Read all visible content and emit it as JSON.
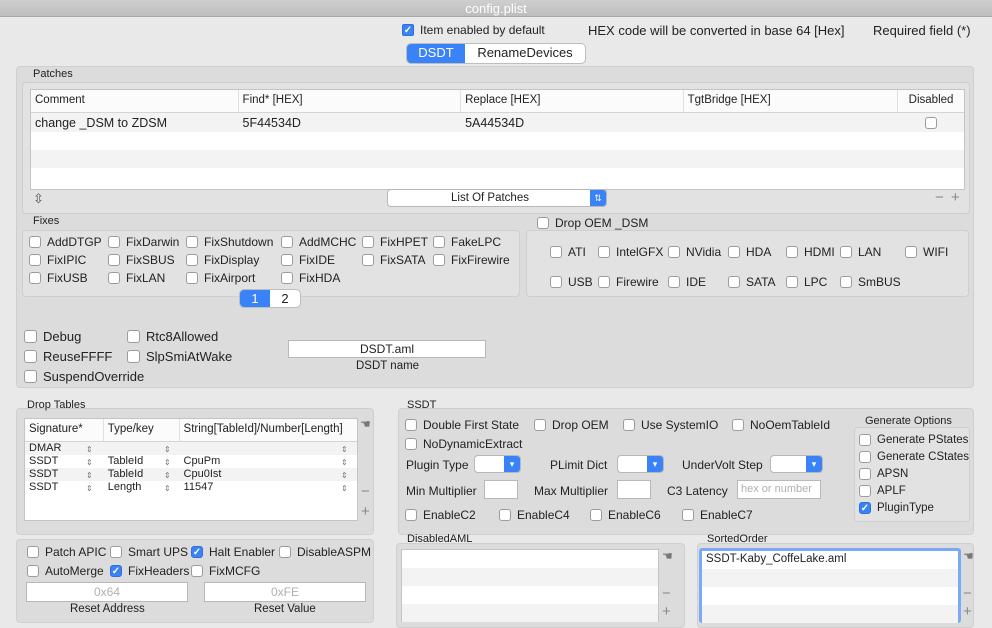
{
  "window": {
    "title": "config.plist"
  },
  "header": {
    "item_enabled_label": "Item enabled by default",
    "hex_note": "HEX code will be converted in base 64 [Hex]",
    "required_note": "Required field (*)"
  },
  "tabs": [
    "DSDT",
    "RenameDevices"
  ],
  "patches": {
    "title": "Patches",
    "columns": [
      "Comment",
      "Find* [HEX]",
      "Replace [HEX]",
      "TgtBridge [HEX]",
      "Disabled"
    ],
    "rows": [
      {
        "comment": "change _DSM to ZDSM",
        "find": "5F44534D",
        "replace": "5A44534D",
        "tgt": ""
      }
    ],
    "list_popup": "List Of Patches"
  },
  "fixes": {
    "title": "Fixes",
    "items": [
      "AddDTGP",
      "FixDarwin",
      "FixShutdown",
      "AddMCHC",
      "FixHPET",
      "FakeLPC",
      "FixIPIC",
      "FixSBUS",
      "FixDisplay",
      "FixIDE",
      "FixSATA",
      "FixFirewire",
      "FixUSB",
      "FixLAN",
      "FixAirport",
      "FixHDA"
    ],
    "pages": [
      "1",
      "2"
    ]
  },
  "drop_oem": {
    "title": "Drop OEM _DSM",
    "items": [
      "ATI",
      "IntelGFX",
      "NVidia",
      "HDA",
      "HDMI",
      "LAN",
      "WIFI",
      "USB",
      "Firewire",
      "IDE",
      "SATA",
      "LPC",
      "SmBUS"
    ]
  },
  "dsdt_options": {
    "items": [
      "Debug",
      "Rtc8Allowed",
      "ReuseFFFF",
      "SlpSmiAtWake",
      "SuspendOverride"
    ],
    "dsdt_name_value": "DSDT.aml",
    "dsdt_name_label": "DSDT name"
  },
  "drop_tables": {
    "title": "Drop Tables",
    "columns": [
      "Signature*",
      "Type/key",
      "String[TableId]/Number[Length]"
    ],
    "rows": [
      {
        "sig": "DMAR",
        "type": "",
        "value": ""
      },
      {
        "sig": "SSDT",
        "type": "TableId",
        "value": "CpuPm"
      },
      {
        "sig": "SSDT",
        "type": "TableId",
        "value": "Cpu0Ist"
      },
      {
        "sig": "SSDT",
        "type": "Length",
        "value": "11547"
      }
    ]
  },
  "ssdt": {
    "title": "SSDT",
    "checks": [
      "Double First State",
      "Drop OEM",
      "Use SystemIO",
      "NoOemTableId",
      "NoDynamicExtract"
    ],
    "plugin_type_label": "Plugin Type",
    "plimit_label": "PLimit Dict",
    "undervolt_label": "UnderVolt Step",
    "min_mult_label": "Min Multiplier",
    "max_mult_label": "Max Multiplier",
    "c3_label": "C3 Latency",
    "c3_placeholder": "hex or number",
    "enable_checks": [
      "EnableC2",
      "EnableC4",
      "EnableC6",
      "EnableC7"
    ],
    "generate_title": "Generate Options",
    "generate": [
      {
        "label": "Generate PStates",
        "checked": false
      },
      {
        "label": "Generate CStates",
        "checked": false
      },
      {
        "label": "APSN",
        "checked": false
      },
      {
        "label": "APLF",
        "checked": false
      },
      {
        "label": "PluginType",
        "checked": true
      }
    ]
  },
  "misc": {
    "items": [
      {
        "label": "Patch APIC",
        "checked": false
      },
      {
        "label": "Smart UPS",
        "checked": false
      },
      {
        "label": "Halt Enabler",
        "checked": true
      },
      {
        "label": "DisableASPM",
        "checked": false
      },
      {
        "label": "AutoMerge",
        "checked": false
      },
      {
        "label": "FixHeaders",
        "checked": true
      },
      {
        "label": "FixMCFG",
        "checked": false
      }
    ],
    "reset_address_placeholder": "0x64",
    "reset_address_label": "Reset Address",
    "reset_value_placeholder": "0xFE",
    "reset_value_label": "Reset Value"
  },
  "disabled_aml": {
    "title": "DisabledAML"
  },
  "sorted_order": {
    "title": "SortedOrder",
    "items": [
      "SSDT-Kaby_CoffeLake.aml"
    ]
  },
  "colors": {
    "accent": "#3a82f7",
    "panel": "#dcdcdc",
    "window": "#e9e9e9"
  }
}
